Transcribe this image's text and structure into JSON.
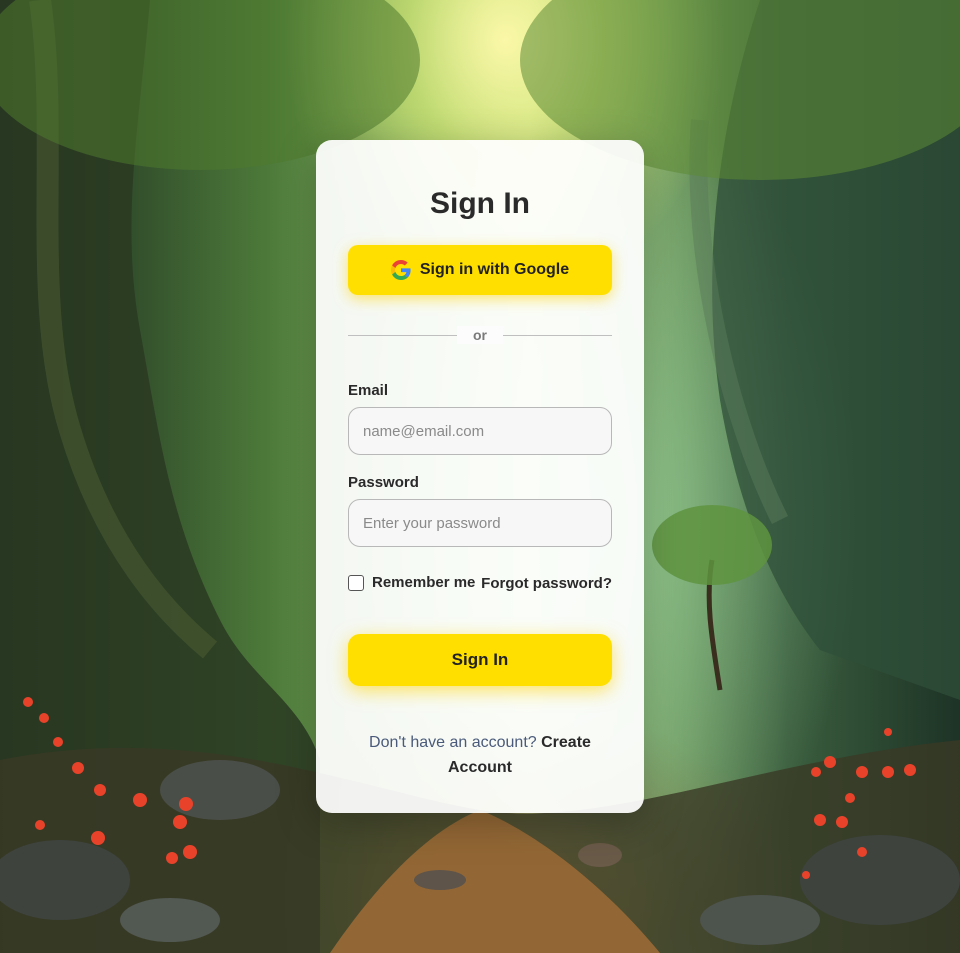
{
  "page": {
    "background_theme": "forest-path-illustration",
    "accent_color": "#ffdf00"
  },
  "signin": {
    "title": "Sign In",
    "google_button_label": "Sign in with Google",
    "divider_text": "or",
    "email_label": "Email",
    "email_placeholder": "name@email.com",
    "email_value": "",
    "password_label": "Password",
    "password_placeholder": "Enter your password",
    "password_value": "",
    "remember_label": "Remember me",
    "remember_checked": false,
    "forgot_label": "Forgot password?",
    "submit_label": "Sign In",
    "footer_prompt": "Don't have an account?",
    "create_account_label": "Create Account"
  },
  "icons": {
    "google": "google-g-icon"
  }
}
